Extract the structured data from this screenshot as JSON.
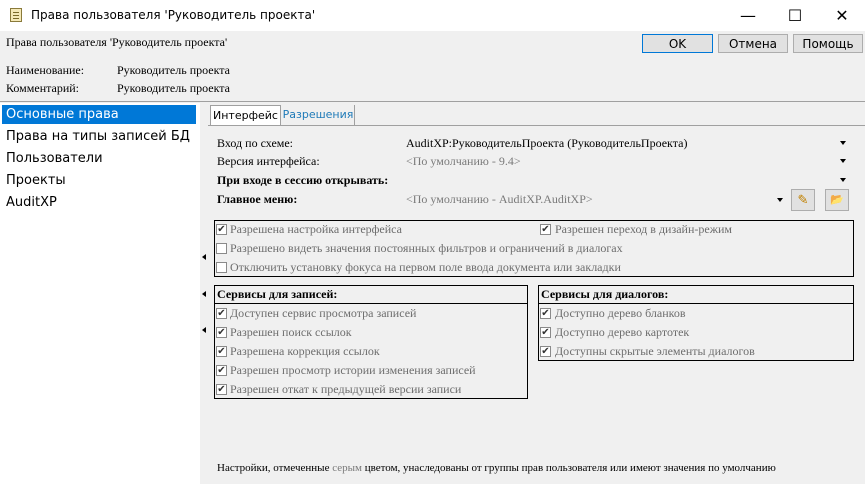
{
  "window": {
    "title": "Права пользователя 'Руководитель проекта'",
    "minimize": "—",
    "maximize": "☐",
    "close": "✕"
  },
  "header": {
    "prompt": "Права пользователя 'Руководитель проекта'",
    "ok_label": "OK",
    "cancel_label": "Отмена",
    "help_label": "Помощь",
    "name_label": "Наименование:",
    "name_value": "Руководитель проекта",
    "comment_label": "Комментарий:",
    "comment_value": "Руководитель проекта"
  },
  "sidebar": {
    "items": [
      {
        "label": "Основные права",
        "selected": true
      },
      {
        "label": "Права на типы записей БД",
        "selected": false
      },
      {
        "label": "Пользователи",
        "selected": false
      },
      {
        "label": "Проекты",
        "selected": false
      },
      {
        "label": "AuditXP",
        "selected": false
      }
    ]
  },
  "tabs": [
    {
      "label": "Интерфейс",
      "active": true
    },
    {
      "label": "Разрешения",
      "active": false
    }
  ],
  "fields": {
    "schema_label": "Вход по схеме:",
    "schema_value": "AuditXP:РуководительПроекта (РуководительПроекта)",
    "version_label": "Версия интерфейса:",
    "version_value": "<По умолчанию - 9.4>",
    "session_label": "При входе в сессию открывать:",
    "session_value": "",
    "menu_label": "Главное меню:",
    "menu_value": "<По умолчанию - AuditXP.AuditXP>"
  },
  "options": {
    "c1": {
      "label": "Разрешена настройка интерфейса",
      "checked": true
    },
    "c2": {
      "label": "Разрешен переход в дизайн-режим",
      "checked": true
    },
    "c3": {
      "label": "Разрешено видеть значения постоянных фильтров и ограничений в диалогах",
      "checked": false
    },
    "c4": {
      "label": "Отключить установку фокуса на первом поле ввода документа или закладки",
      "checked": false
    }
  },
  "records_services": {
    "title": "Сервисы для записей:",
    "items": [
      {
        "label": "Доступен сервис просмотра записей",
        "checked": true
      },
      {
        "label": "Разрешен поиск ссылок",
        "checked": true
      },
      {
        "label": "Разрешена коррекция ссылок",
        "checked": true
      },
      {
        "label": "Разрешен просмотр истории изменения записей",
        "checked": true
      },
      {
        "label": "Разрешен откат к предыдущей версии записи",
        "checked": true
      }
    ]
  },
  "dialog_services": {
    "title": "Сервисы для диалогов:",
    "items": [
      {
        "label": "Доступно дерево бланков",
        "checked": true
      },
      {
        "label": "Доступно дерево картотек",
        "checked": true
      },
      {
        "label": "Доступны скрытые элементы диалогов",
        "checked": true
      }
    ]
  },
  "footer": {
    "note_part1": "Настройки, отмеченные",
    "note_grey": "серым",
    "note_part2": "цветом, унаследованы от группы прав пользователя или имеют значения по умолчанию"
  },
  "icons": {
    "edit": "✎",
    "open": "📂",
    "check": "✔"
  }
}
